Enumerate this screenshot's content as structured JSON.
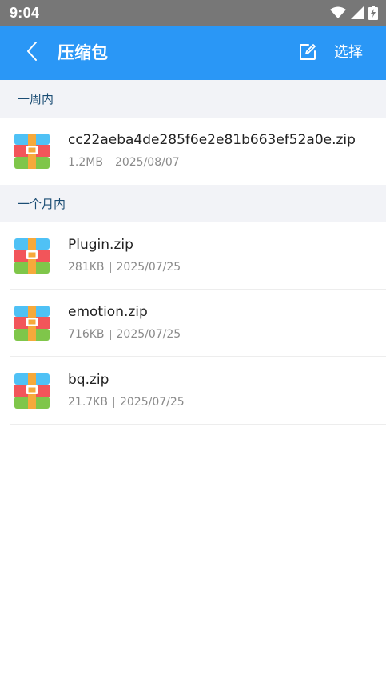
{
  "status_bar": {
    "time": "9:04",
    "icons": [
      "wifi-icon",
      "signal-icon",
      "battery-charging-icon"
    ]
  },
  "app_bar": {
    "title": "压缩包",
    "select_label": "选择",
    "icons": [
      "back-chevron-icon",
      "edit-icon"
    ]
  },
  "sections": [
    {
      "header": "一周内",
      "files": [
        {
          "name": "cc22aeba4de285f6e2e81b663ef52a0e.zip",
          "size": "1.2MB",
          "date": "2025/08/07",
          "icon": "archive-icon"
        }
      ]
    },
    {
      "header": "一个月内",
      "files": [
        {
          "name": "Plugin.zip",
          "size": "281KB",
          "date": "2025/07/25",
          "icon": "archive-icon"
        },
        {
          "name": "emotion.zip",
          "size": "716KB",
          "date": "2025/07/25",
          "icon": "archive-icon"
        },
        {
          "name": "bq.zip",
          "size": "21.7KB",
          "date": "2025/07/25",
          "icon": "archive-icon"
        }
      ]
    }
  ],
  "colors": {
    "accent": "#2a97f6",
    "status_bar": "#777777",
    "section_bg": "#f2f3f7",
    "section_text": "#1b4d74"
  }
}
